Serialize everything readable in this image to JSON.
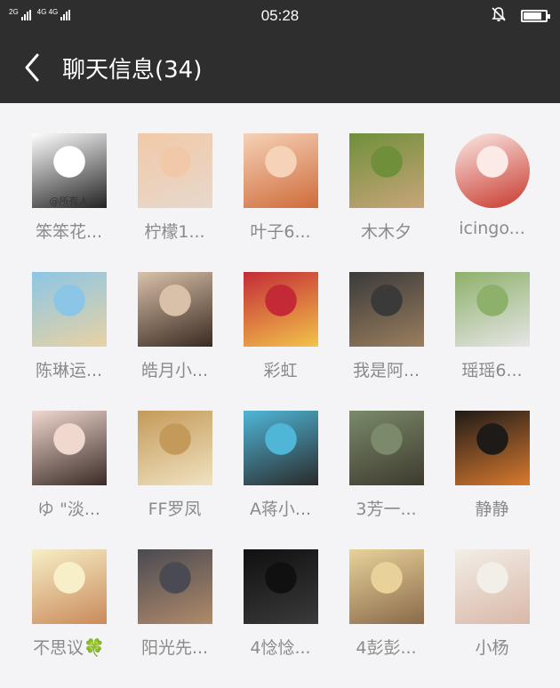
{
  "status_bar": {
    "network_1": "2G",
    "network_2": "4G 4G",
    "time": "05:28",
    "icons": [
      "signal-icon",
      "signal-icon",
      "mute-bell-icon",
      "battery-icon"
    ],
    "battery_level": 0.85
  },
  "header": {
    "back_icon": "chevron-left-icon",
    "title": "聊天信息(34)"
  },
  "members": [
    {
      "name": "笨笨花...",
      "avatar_caption": "@所有人",
      "colors": [
        "#ffffff",
        "#222222"
      ]
    },
    {
      "name": "柠檬1...",
      "colors": [
        "#f2c9a8",
        "#e7d8cc"
      ]
    },
    {
      "name": "叶子6...",
      "colors": [
        "#f5d2b8",
        "#cf6b3a"
      ]
    },
    {
      "name": "木木夕",
      "colors": [
        "#6f8f3a",
        "#c9a57a"
      ]
    },
    {
      "name": "icingo...",
      "colors": [
        "#fbeae6",
        "#c8382c"
      ]
    },
    {
      "name": "陈琳运...",
      "colors": [
        "#8cc6e6",
        "#e8d2a3"
      ]
    },
    {
      "name": "皓月小...",
      "colors": [
        "#d9c1a9",
        "#3a2a22"
      ]
    },
    {
      "name": "彩虹",
      "colors": [
        "#c42a36",
        "#f2c44a"
      ]
    },
    {
      "name": "我是阿...",
      "colors": [
        "#3a3a3a",
        "#9a7e5e"
      ]
    },
    {
      "name": "瑶瑶6...",
      "colors": [
        "#8db06a",
        "#e6e6e6"
      ]
    },
    {
      "name": "ゆ \"淡...",
      "colors": [
        "#f0d8cf",
        "#3a2a26"
      ]
    },
    {
      "name": "FF罗凤",
      "colors": [
        "#c49a5a",
        "#f0e2c0"
      ]
    },
    {
      "name": "A蒋小...",
      "colors": [
        "#4fb6d8",
        "#2a2a2a"
      ]
    },
    {
      "name": "3芳一...",
      "colors": [
        "#7a8a6a",
        "#3e3a2e"
      ]
    },
    {
      "name": "静静",
      "colors": [
        "#1e1a18",
        "#d97a2e"
      ]
    },
    {
      "name": "不思议🍀",
      "colors": [
        "#f7efc7",
        "#c98a5a"
      ]
    },
    {
      "name": "阳光先...",
      "colors": [
        "#4a4a52",
        "#b08a6a"
      ]
    },
    {
      "name": "4惗惗...",
      "colors": [
        "#101010",
        "#3a3a3a"
      ]
    },
    {
      "name": "4彭彭...",
      "colors": [
        "#e8d29a",
        "#8a6a4a"
      ]
    },
    {
      "name": "小杨",
      "colors": [
        "#f2eee8",
        "#d9b8a8"
      ]
    }
  ]
}
